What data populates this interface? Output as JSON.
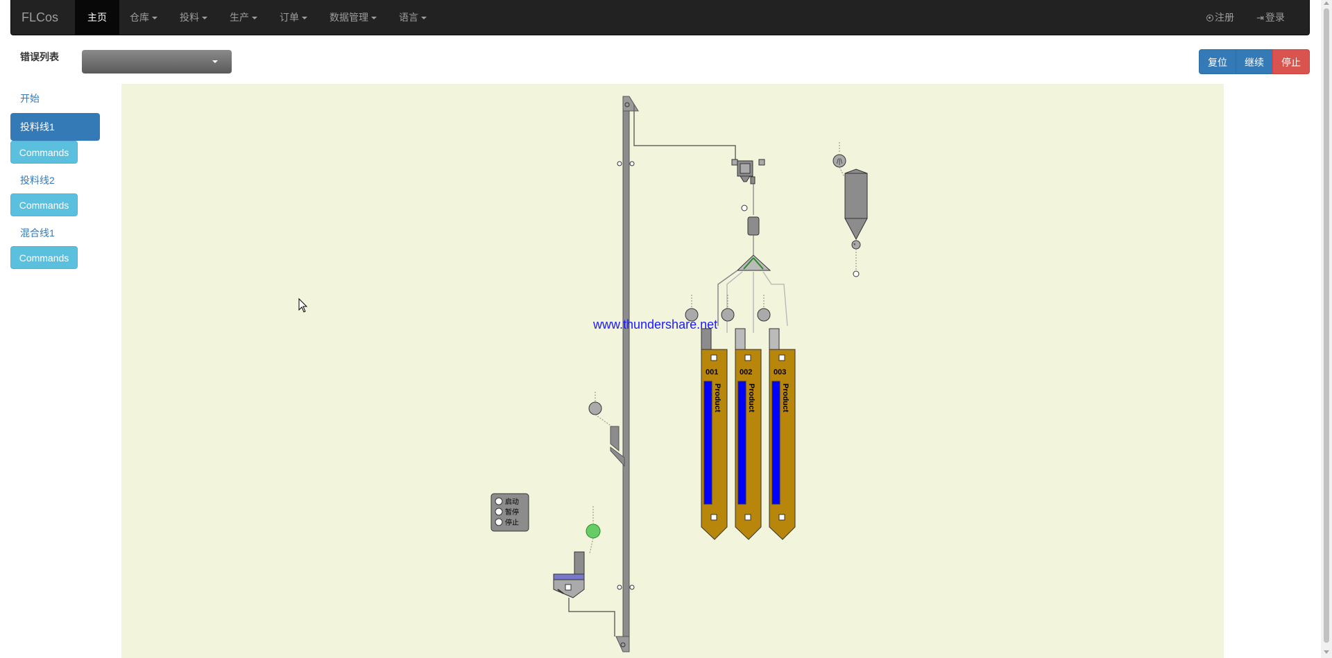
{
  "navbar": {
    "brand": "FLCos",
    "items": [
      {
        "label": "主页",
        "active": true
      },
      {
        "label": "仓库",
        "dropdown": true
      },
      {
        "label": "投料",
        "dropdown": true
      },
      {
        "label": "生产",
        "dropdown": true
      },
      {
        "label": "订单",
        "dropdown": true
      },
      {
        "label": "数据管理",
        "dropdown": true
      },
      {
        "label": "语言",
        "dropdown": true
      }
    ],
    "register": "注册",
    "login": "登录"
  },
  "error_list": {
    "label": "错误列表",
    "selected": ""
  },
  "actions": {
    "reset": "复位",
    "continue": "继续",
    "stop": "停止"
  },
  "sidebar": {
    "start": "开始",
    "line1": "投料线1",
    "line2": "投料线2",
    "mix1": "混合线1",
    "commands": "Commands"
  },
  "diagram": {
    "watermark": "www.thundershare.net",
    "bins": [
      {
        "id": "001",
        "label": "Product",
        "level": 1.0
      },
      {
        "id": "002",
        "label": "Product",
        "level": 1.0
      },
      {
        "id": "003",
        "label": "Product",
        "level": 1.0
      }
    ],
    "control_panel": {
      "start": "启动",
      "pause": "暂停",
      "stop": "停止"
    },
    "colors": {
      "background": "#f3f4dc",
      "bin": "#b8860b",
      "level": "#0000ff",
      "motor_active": "#66cc66",
      "equipment": "#909090"
    }
  }
}
